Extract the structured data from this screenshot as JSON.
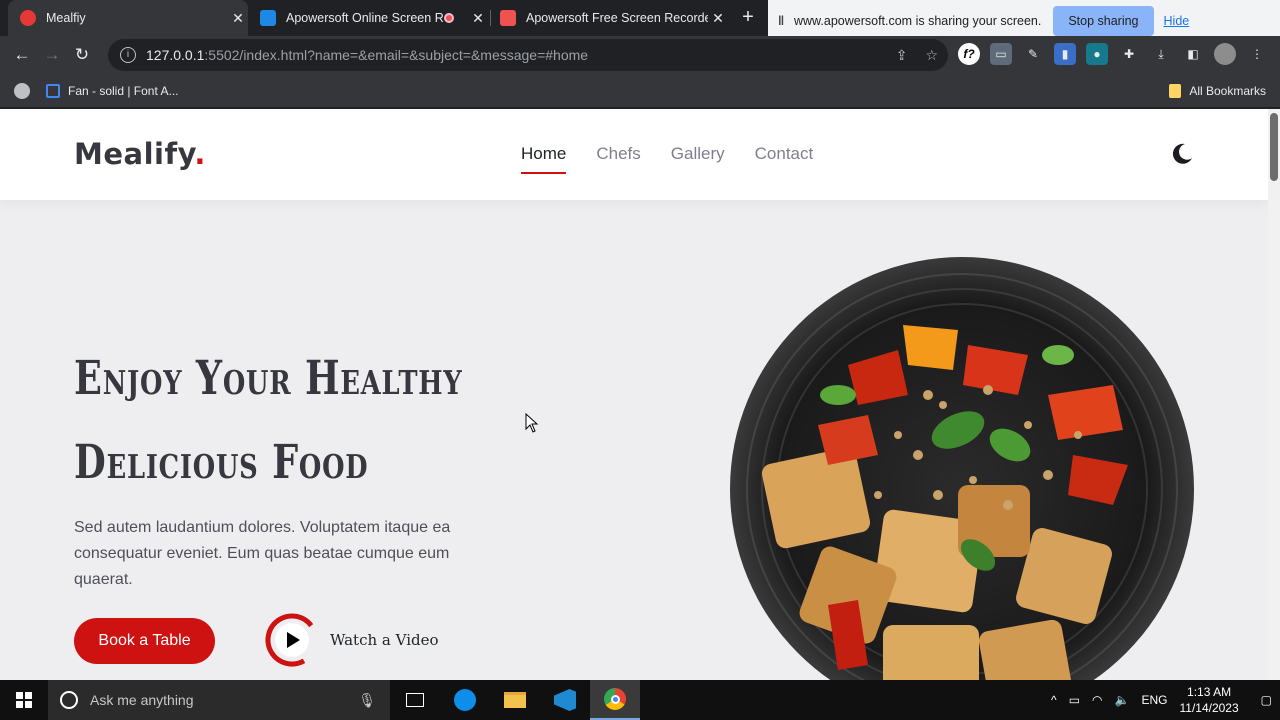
{
  "browser": {
    "tabs": [
      {
        "title": "Mealfiy",
        "favicon_color": "#e53935",
        "active": true
      },
      {
        "title": "Apowersoft Online Screen R",
        "favicon_color": "#1e88e5",
        "active": false
      },
      {
        "title": "Apowersoft Free Screen Recorde",
        "favicon_color": "#ef5350",
        "active": false
      }
    ],
    "new_tab_label": "+",
    "share_notice": {
      "text": "www.apowersoft.com is sharing your screen.",
      "stop_label": "Stop sharing",
      "hide_label": "Hide"
    },
    "address": {
      "host": "127.0.0.1",
      "rest": ":5502/index.html?name=&email=&subject=&message=#home"
    },
    "bookmarks": [
      {
        "label": "Fan - solid | Font A..."
      }
    ],
    "all_bookmarks_label": "All Bookmarks"
  },
  "site": {
    "logo_text": "Mealify",
    "logo_dot": ".",
    "accent": "#ce1212",
    "nav": [
      {
        "label": "Home",
        "active": true
      },
      {
        "label": "Chefs",
        "active": false
      },
      {
        "label": "Gallery",
        "active": false
      },
      {
        "label": "Contact",
        "active": false
      }
    ],
    "theme_toggle_icon": "moon-icon",
    "hero": {
      "title_line1": "Enjoy Your Healthy",
      "title_line2": "Delicious Food",
      "text": "Sed autem laudantium dolores. Voluptatem itaque ea consequatur eveniet. Eum quas beatae cumque eum quaerat.",
      "book_label": "Book a Table",
      "watch_label": "Watch a Video"
    }
  },
  "taskbar": {
    "search_placeholder": "Ask me anything",
    "language": "ENG",
    "time": "1:13 AM",
    "date": "11/14/2023"
  }
}
